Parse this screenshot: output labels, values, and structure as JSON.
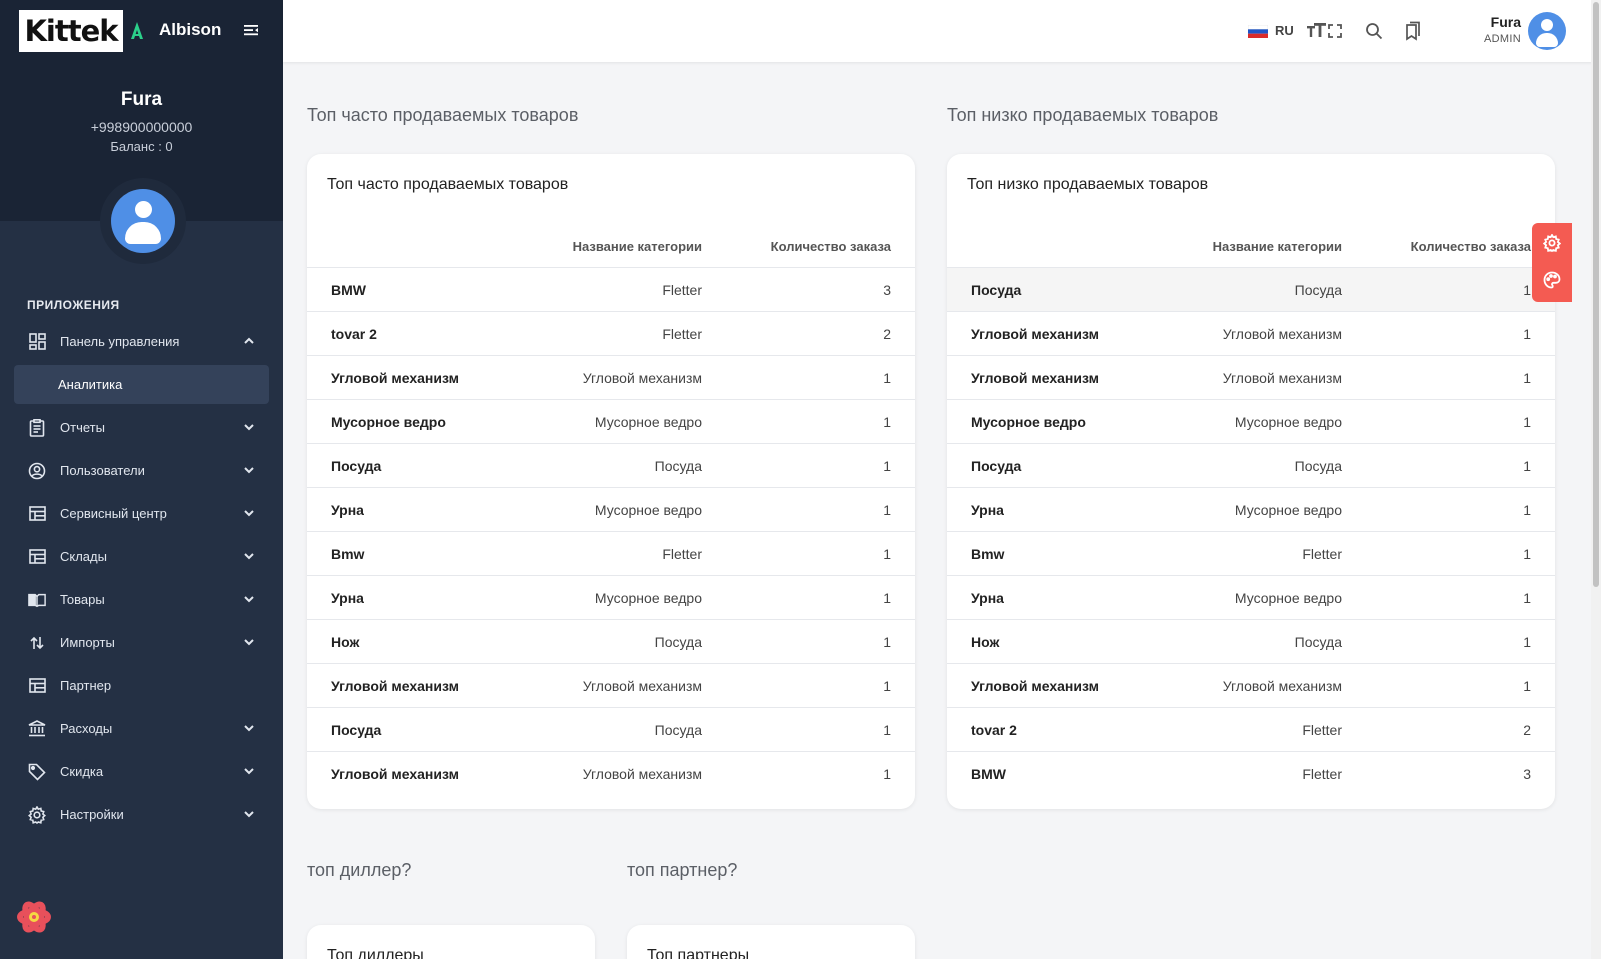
{
  "brand": {
    "logo_text": "Kittek",
    "name": "Albison"
  },
  "profile": {
    "name": "Fura",
    "phone": "+998900000000",
    "balance": "Баланс : 0"
  },
  "sidebar": {
    "section_label": "ПРИЛОЖЕНИЯ",
    "items": [
      {
        "label": "Панель управления",
        "icon": "dashboard-icon",
        "chevron": "up"
      },
      {
        "label": "Аналитика",
        "sub": true
      },
      {
        "label": "Отчеты",
        "icon": "reports-icon",
        "chevron": "down"
      },
      {
        "label": "Пользователи",
        "icon": "users-icon",
        "chevron": "down"
      },
      {
        "label": "Сервисный центр",
        "icon": "service-icon",
        "chevron": "down"
      },
      {
        "label": "Склады",
        "icon": "warehouse-icon",
        "chevron": "down"
      },
      {
        "label": "Товары",
        "icon": "book-icon",
        "chevron": "down"
      },
      {
        "label": "Импорты",
        "icon": "import-icon",
        "chevron": "down"
      },
      {
        "label": "Партнер",
        "icon": "partner-icon",
        "chevron": ""
      },
      {
        "label": "Расходы",
        "icon": "bank-icon",
        "chevron": "down"
      },
      {
        "label": "Скидка",
        "icon": "tag-icon",
        "chevron": "down"
      },
      {
        "label": "Настройки",
        "icon": "gear-icon",
        "chevron": "down"
      }
    ]
  },
  "header": {
    "lang": "RU",
    "user_name": "Fura",
    "user_role": "ADMIN"
  },
  "top_selling": {
    "section_title": "Топ часто продаваемых товаров",
    "card_title": "Топ часто продаваемых товаров",
    "col_category": "Название категории",
    "col_qty": "Количество заказа",
    "rows": [
      {
        "name": "BMW",
        "category": "Fletter",
        "qty": "3"
      },
      {
        "name": "tovar 2",
        "category": "Fletter",
        "qty": "2"
      },
      {
        "name": "Угловой механизм",
        "category": "Угловой механизм",
        "qty": "1"
      },
      {
        "name": "Мусорное ведро",
        "category": "Мусорное ведро",
        "qty": "1"
      },
      {
        "name": "Посуда",
        "category": "Посуда",
        "qty": "1"
      },
      {
        "name": "Урна",
        "category": "Мусорное ведро",
        "qty": "1"
      },
      {
        "name": "Bmw",
        "category": "Fletter",
        "qty": "1"
      },
      {
        "name": "Урна",
        "category": "Мусорное ведро",
        "qty": "1"
      },
      {
        "name": "Нож",
        "category": "Посуда",
        "qty": "1"
      },
      {
        "name": "Угловой механизм",
        "category": "Угловой механизм",
        "qty": "1"
      },
      {
        "name": "Посуда",
        "category": "Посуда",
        "qty": "1"
      },
      {
        "name": "Угловой механизм",
        "category": "Угловой механизм",
        "qty": "1"
      }
    ]
  },
  "low_selling": {
    "section_title": "Топ низко продаваемых товаров",
    "card_title": "Топ низко продаваемых товаров",
    "col_category": "Название категории",
    "col_qty": "Количество заказа",
    "rows": [
      {
        "name": "Посуда",
        "category": "Посуда",
        "qty": "1"
      },
      {
        "name": "Угловой механизм",
        "category": "Угловой механизм",
        "qty": "1"
      },
      {
        "name": "Угловой механизм",
        "category": "Угловой механизм",
        "qty": "1"
      },
      {
        "name": "Мусорное ведро",
        "category": "Мусорное ведро",
        "qty": "1"
      },
      {
        "name": "Посуда",
        "category": "Посуда",
        "qty": "1"
      },
      {
        "name": "Урна",
        "category": "Мусорное ведро",
        "qty": "1"
      },
      {
        "name": "Bmw",
        "category": "Fletter",
        "qty": "1"
      },
      {
        "name": "Урна",
        "category": "Мусорное ведро",
        "qty": "1"
      },
      {
        "name": "Нож",
        "category": "Посуда",
        "qty": "1"
      },
      {
        "name": "Угловой механизм",
        "category": "Угловой механизм",
        "qty": "1"
      },
      {
        "name": "tovar 2",
        "category": "Fletter",
        "qty": "2"
      },
      {
        "name": "BMW",
        "category": "Fletter",
        "qty": "3"
      }
    ]
  },
  "dealers": {
    "section_title": "топ диллер?",
    "card_title": "Топ диллеры"
  },
  "partners": {
    "section_title": "топ партнер?",
    "card_title": "Топ партнеры"
  },
  "colors": {
    "sidebar_bg": "#243044",
    "accent": "#4f8fe6",
    "float_panel": "#f45b52"
  }
}
